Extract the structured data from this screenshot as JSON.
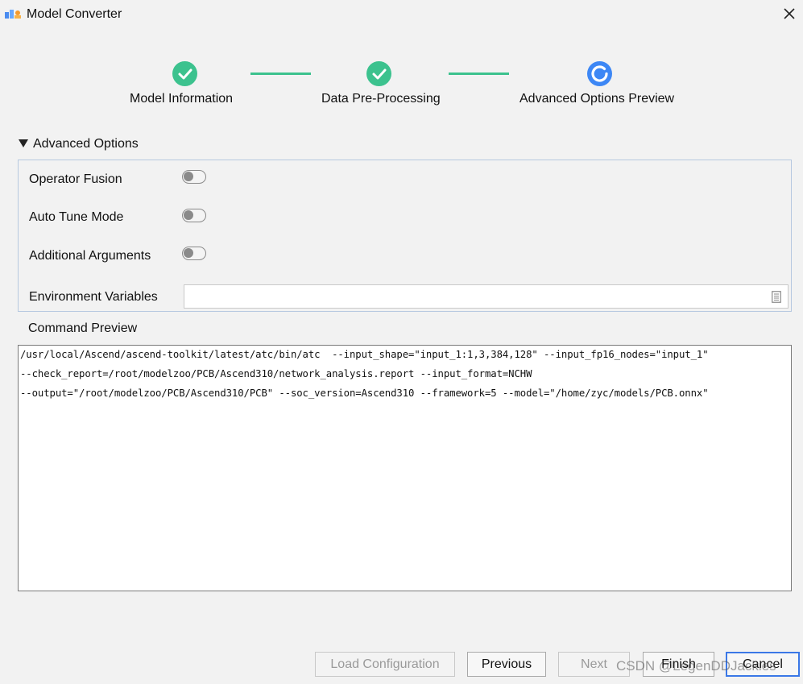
{
  "window": {
    "title": "Model Converter",
    "close_icon": "close-icon",
    "logo_icon": "app-logo-icon"
  },
  "stepper": {
    "steps": [
      {
        "label": "Model Information",
        "state": "completed",
        "icon": "check-icon"
      },
      {
        "label": "Data Pre-Processing",
        "state": "completed",
        "icon": "check-icon"
      },
      {
        "label": "Advanced Options  Preview",
        "state": "current",
        "icon": "progress-ring-icon"
      }
    ],
    "completed_color": "#3cc28e",
    "current_color": "#3d87f5"
  },
  "advanced_options": {
    "title": "Advanced Options",
    "expanded": true,
    "options": [
      {
        "label": "Operator Fusion",
        "enabled": false
      },
      {
        "label": "Auto Tune Mode",
        "enabled": false
      },
      {
        "label": "Additional Arguments",
        "enabled": false
      }
    ],
    "env_vars": {
      "label": "Environment Variables",
      "value": "",
      "icon": "document-icon"
    }
  },
  "command_preview": {
    "title": "Command Preview",
    "lines": [
      "/usr/local/Ascend/ascend-toolkit/latest/atc/bin/atc  --input_shape=\"input_1:1,3,384,128\" --input_fp16_nodes=\"input_1\"",
      "--check_report=/root/modelzoo/PCB/Ascend310/network_analysis.report --input_format=NCHW",
      "--output=\"/root/modelzoo/PCB/Ascend310/PCB\" --soc_version=Ascend310 --framework=5 --model=\"/home/zyc/models/PCB.onnx\""
    ]
  },
  "buttons": {
    "load_configuration": {
      "label": "Load Configuration",
      "enabled": false
    },
    "previous": {
      "label": "Previous",
      "enabled": true
    },
    "next": {
      "label": "Next",
      "enabled": false
    },
    "finish": {
      "label": "Finish",
      "enabled": true
    },
    "cancel": {
      "label": "Cancel",
      "enabled": true,
      "focused": true
    }
  },
  "watermark": "CSDN @LegenDDJackies"
}
